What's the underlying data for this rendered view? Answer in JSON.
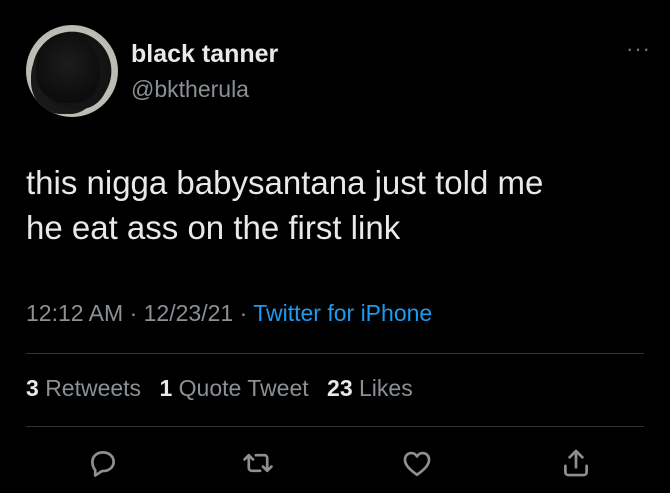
{
  "tweet": {
    "display_name": "black tanner",
    "handle": "@bktherula",
    "more_label": "···",
    "text_lines": [
      "this nigga babysantana just told me",
      "he eat ass on the first link"
    ],
    "time": "12:12 AM",
    "separator": "·",
    "date": "12/23/21",
    "source": "Twitter for iPhone",
    "stats": {
      "retweets_count": "3",
      "retweets_label": "Retweets",
      "quotes_count": "1",
      "quotes_label": "Quote Tweet",
      "likes_count": "23",
      "likes_label": "Likes"
    },
    "actions": [
      "reply-icon",
      "retweet-icon",
      "like-icon",
      "share-icon"
    ]
  },
  "colors": {
    "background": "#000000",
    "text_primary": "#e7e9ea",
    "text_secondary": "#8b9095",
    "link": "#1d9bf0",
    "divider": "#2f3336"
  }
}
